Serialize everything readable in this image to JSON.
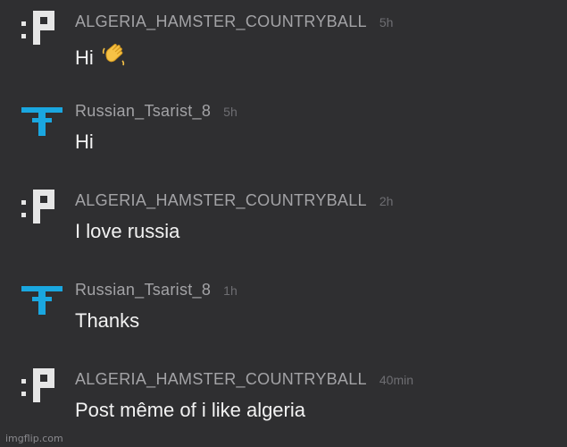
{
  "colors": {
    "background": "#2f2f31",
    "username": "#a3a3a6",
    "timestamp": "#6e6e72",
    "message_text": "#f2f2f2",
    "algeria_icon": "#e6e6e6",
    "russian_icon": "#1aa7e0"
  },
  "messages": [
    {
      "username": "ALGERIA_HAMSTER_COUNTRYBALL",
      "time": "5h",
      "text": "Hi",
      "icon": "algeria-flair-icon",
      "reaction_emoji": "waving-hand-emoji"
    },
    {
      "username": "Russian_Tsarist_8",
      "time": "5h",
      "text": "Hi",
      "icon": "russian-flair-icon"
    },
    {
      "username": "ALGERIA_HAMSTER_COUNTRYBALL",
      "time": "2h",
      "text": "I love russia",
      "icon": "algeria-flair-icon"
    },
    {
      "username": "Russian_Tsarist_8",
      "time": "1h",
      "text": "Thanks",
      "icon": "russian-flair-icon"
    },
    {
      "username": "ALGERIA_HAMSTER_COUNTRYBALL",
      "time": "40min",
      "text": "Post même of i like algeria",
      "icon": "algeria-flair-icon"
    }
  ],
  "watermark": "imgflip.com"
}
